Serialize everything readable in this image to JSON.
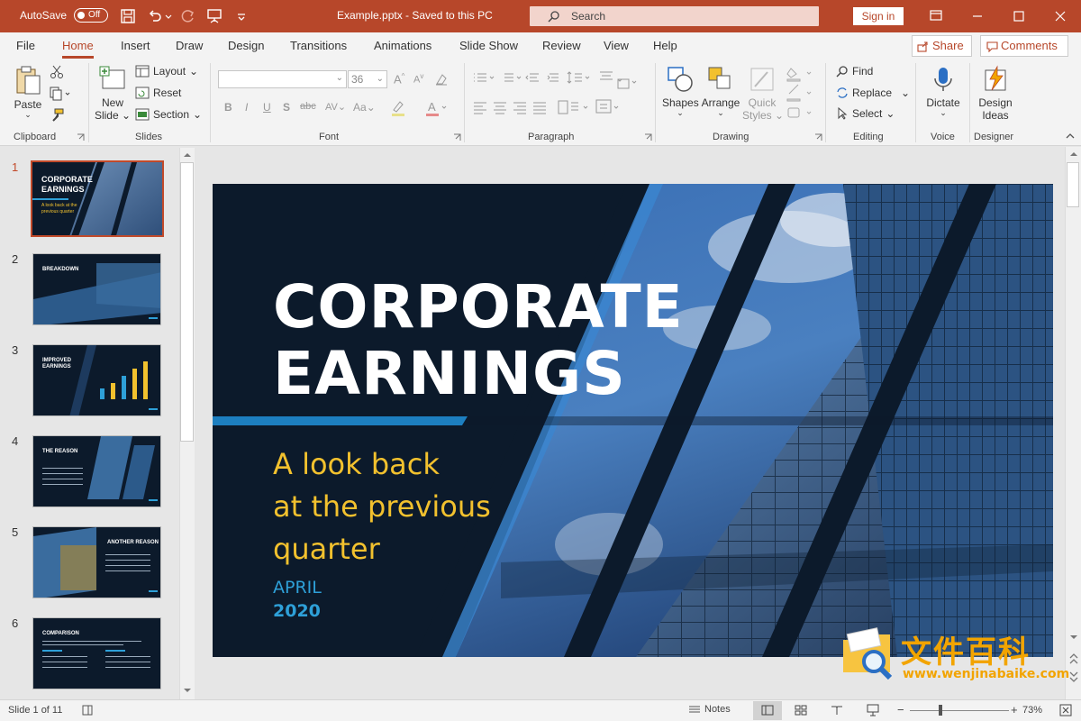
{
  "titlebar": {
    "autosave_label": "AutoSave",
    "autosave_state": "Off",
    "document_title": "Example.pptx  -  Saved to this PC",
    "search_placeholder": "Search",
    "signin_label": "Sign in"
  },
  "tabs": [
    "File",
    "Home",
    "Insert",
    "Draw",
    "Design",
    "Transitions",
    "Animations",
    "Slide Show",
    "Review",
    "View",
    "Help"
  ],
  "active_tab": "Home",
  "share_label": "Share",
  "comments_label": "Comments",
  "ribbon": {
    "clipboard": {
      "label": "Clipboard",
      "paste": "Paste"
    },
    "slides": {
      "label": "Slides",
      "new_slide_1": "New",
      "new_slide_2": "Slide",
      "layout": "Layout",
      "reset": "Reset",
      "section": "Section"
    },
    "font": {
      "label": "Font",
      "font_size": "36",
      "bold": "B",
      "italic": "I",
      "underline": "U",
      "shadow": "S",
      "strike": "abc",
      "spacing": "AV",
      "case": "Aa"
    },
    "paragraph": {
      "label": "Paragraph"
    },
    "drawing": {
      "label": "Drawing",
      "shapes": "Shapes",
      "arrange": "Arrange",
      "quick_styles_1": "Quick",
      "quick_styles_2": "Styles"
    },
    "editing": {
      "label": "Editing",
      "find": "Find",
      "replace": "Replace",
      "select": "Select"
    },
    "voice": {
      "label": "Voice",
      "dictate": "Dictate"
    },
    "designer": {
      "label": "Designer",
      "design_ideas_1": "Design",
      "design_ideas_2": "Ideas"
    }
  },
  "thumbnails": [
    {
      "num": "1",
      "title_l1": "CORPORATE",
      "title_l2": "EARNINGS",
      "sub": "A look back at the previous quarter"
    },
    {
      "num": "2",
      "title_l1": "BREAKDOWN",
      "title_l2": ""
    },
    {
      "num": "3",
      "title_l1": "IMPROVED",
      "title_l2": "EARNINGS"
    },
    {
      "num": "4",
      "title_l1": "THE REASON",
      "title_l2": ""
    },
    {
      "num": "5",
      "title_l1": "ANOTHER REASON",
      "title_l2": ""
    },
    {
      "num": "6",
      "title_l1": "COMPARISON",
      "title_l2": ""
    }
  ],
  "slide": {
    "title_l1": "CORPORATE",
    "title_l2": "EARNINGS",
    "sub_l1": "A look back",
    "sub_l2": "at the previous",
    "sub_l3": "quarter",
    "month": "APRIL",
    "year": "2020"
  },
  "status": {
    "slide_info": "Slide 1 of 11",
    "notes_label": "Notes",
    "zoom": "73%"
  },
  "watermark": {
    "cn": "文件百科",
    "url": "www.wenjinabaike.com"
  },
  "colors": {
    "accent": "#b7472a",
    "slide_bg": "#0c1a2b",
    "slide_yellow": "#f2c12e",
    "slide_blue": "#2ea0d8"
  }
}
